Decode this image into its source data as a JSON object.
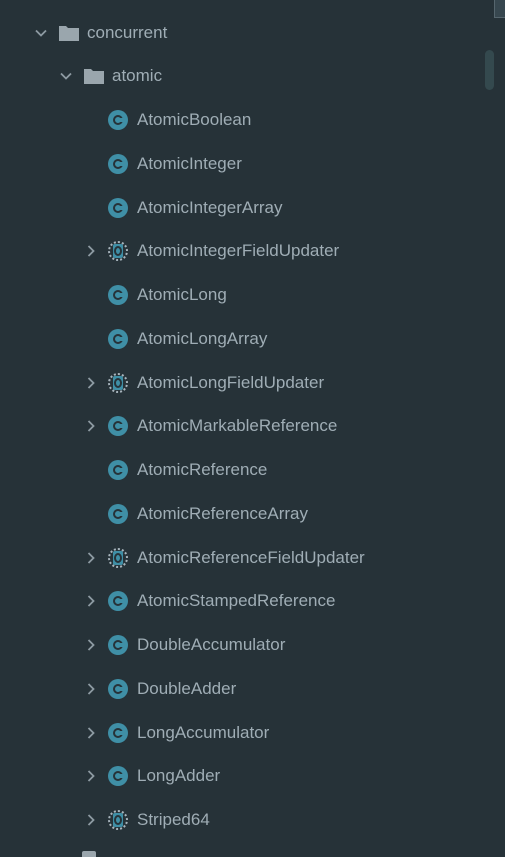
{
  "tree": {
    "root": {
      "label": "concurrent",
      "icon": "folder-icon",
      "expanded": true
    },
    "package": {
      "label": "atomic",
      "icon": "folder-icon",
      "expanded": true
    },
    "items": [
      {
        "label": "AtomicBoolean",
        "icon": "class-icon",
        "expandable": false
      },
      {
        "label": "AtomicInteger",
        "icon": "class-icon",
        "expandable": false
      },
      {
        "label": "AtomicIntegerArray",
        "icon": "class-icon",
        "expandable": false
      },
      {
        "label": "AtomicIntegerFieldUpdater",
        "icon": "abstract-class-icon",
        "expandable": true
      },
      {
        "label": "AtomicLong",
        "icon": "class-icon",
        "expandable": false
      },
      {
        "label": "AtomicLongArray",
        "icon": "class-icon",
        "expandable": false
      },
      {
        "label": "AtomicLongFieldUpdater",
        "icon": "abstract-class-icon",
        "expandable": true
      },
      {
        "label": "AtomicMarkableReference",
        "icon": "class-icon",
        "expandable": true
      },
      {
        "label": "AtomicReference",
        "icon": "class-icon",
        "expandable": false
      },
      {
        "label": "AtomicReferenceArray",
        "icon": "class-icon",
        "expandable": false
      },
      {
        "label": "AtomicReferenceFieldUpdater",
        "icon": "abstract-class-icon",
        "expandable": true
      },
      {
        "label": "AtomicStampedReference",
        "icon": "class-icon",
        "expandable": true
      },
      {
        "label": "DoubleAccumulator",
        "icon": "class-icon",
        "expandable": true
      },
      {
        "label": "DoubleAdder",
        "icon": "class-icon",
        "expandable": true
      },
      {
        "label": "LongAccumulator",
        "icon": "class-icon",
        "expandable": true
      },
      {
        "label": "LongAdder",
        "icon": "class-icon",
        "expandable": true
      },
      {
        "label": "Striped64",
        "icon": "abstract-class-icon",
        "expandable": true
      }
    ]
  },
  "colors": {
    "background": "#263238",
    "text": "#9fadb5",
    "class_icon": "#3f8fa6",
    "folder": "#9aa6ad",
    "chevron": "#8d9aa2"
  }
}
